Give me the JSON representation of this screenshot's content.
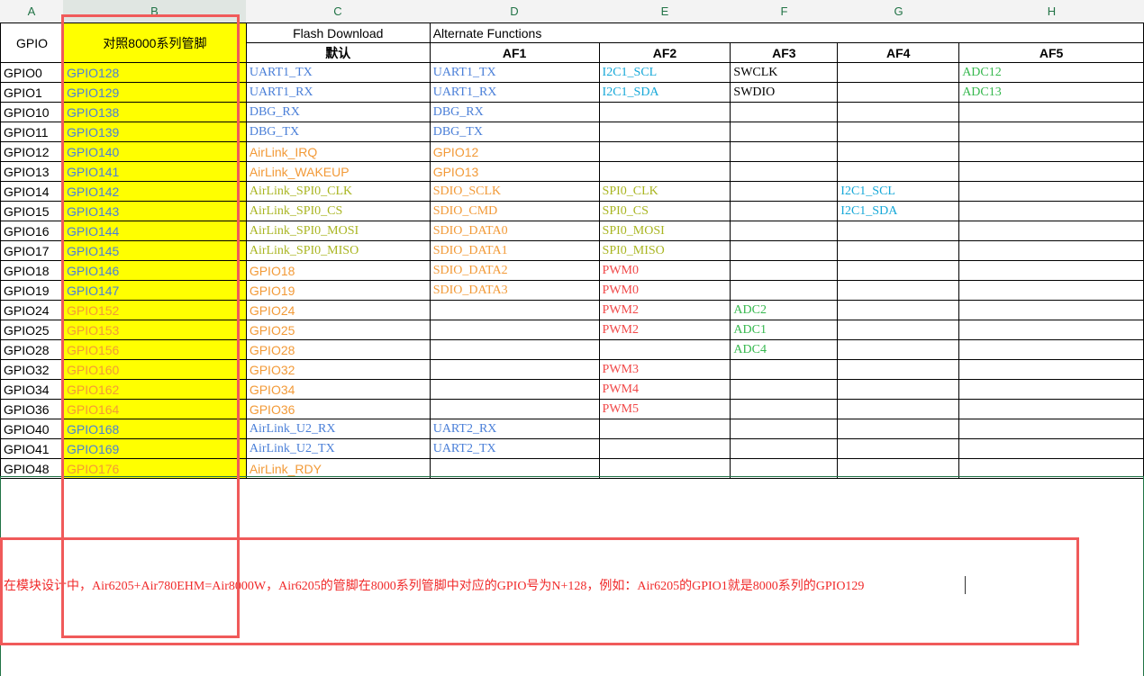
{
  "columns": [
    "A",
    "B",
    "C",
    "D",
    "E",
    "F",
    "G",
    "H"
  ],
  "header": {
    "gpio": "GPIO",
    "mapping": "对照8000系列管脚",
    "flash_download": "Flash Download",
    "alternate_functions": "Alternate Functions",
    "default": "默认",
    "af1": "AF1",
    "af2": "AF2",
    "af3": "AF3",
    "af4": "AF4",
    "af5": "AF5"
  },
  "rows": [
    {
      "gpio": "GPIO0",
      "b": "GPIO128",
      "c": "UART1_TX",
      "d": "UART1_TX",
      "e": "I2C1_SCL",
      "f": "SWCLK",
      "g": "",
      "h": "ADC12"
    },
    {
      "gpio": "GPIO1",
      "b": "GPIO129",
      "c": "UART1_RX",
      "d": "UART1_RX",
      "e": "I2C1_SDA",
      "f": "SWDIO",
      "g": "",
      "h": "ADC13"
    },
    {
      "gpio": "GPIO10",
      "b": "GPIO138",
      "c": "DBG_RX",
      "d": "DBG_RX",
      "e": "",
      "f": "",
      "g": "",
      "h": ""
    },
    {
      "gpio": "GPIO11",
      "b": "GPIO139",
      "c": "DBG_TX",
      "d": "DBG_TX",
      "e": "",
      "f": "",
      "g": "",
      "h": ""
    },
    {
      "gpio": "GPIO12",
      "b": "GPIO140",
      "c": "AirLink_IRQ",
      "d": "GPIO12",
      "e": "",
      "f": "",
      "g": "",
      "h": ""
    },
    {
      "gpio": "GPIO13",
      "b": "GPIO141",
      "c": "AirLink_WAKEUP",
      "d": "GPIO13",
      "e": "",
      "f": "",
      "g": "",
      "h": ""
    },
    {
      "gpio": "GPIO14",
      "b": "GPIO142",
      "c": "AirLink_SPI0_CLK",
      "d": "SDIO_SCLK",
      "e": "SPI0_CLK",
      "f": "",
      "g": "I2C1_SCL",
      "h": ""
    },
    {
      "gpio": "GPIO15",
      "b": "GPIO143",
      "c": "AirLink_SPI0_CS",
      "d": "SDIO_CMD",
      "e": "SPI0_CS",
      "f": "",
      "g": "I2C1_SDA",
      "h": ""
    },
    {
      "gpio": "GPIO16",
      "b": "GPIO144",
      "c": "AirLink_SPI0_MOSI",
      "d": "SDIO_DATA0",
      "e": "SPI0_MOSI",
      "f": "",
      "g": "",
      "h": ""
    },
    {
      "gpio": "GPIO17",
      "b": "GPIO145",
      "c": "AirLink_SPI0_MISO",
      "d": "SDIO_DATA1",
      "e": "SPI0_MISO",
      "f": "",
      "g": "",
      "h": ""
    },
    {
      "gpio": "GPIO18",
      "b": "GPIO146",
      "c": "GPIO18",
      "d": "SDIO_DATA2",
      "e": "PWM0",
      "f": "",
      "g": "",
      "h": ""
    },
    {
      "gpio": "GPIO19",
      "b": "GPIO147",
      "c": "GPIO19",
      "d": "SDIO_DATA3",
      "e": "PWM0",
      "f": "",
      "g": "",
      "h": ""
    },
    {
      "gpio": "GPIO24",
      "b": "GPIO152",
      "c": "GPIO24",
      "d": "",
      "e": "PWM2",
      "f": "ADC2",
      "g": "",
      "h": ""
    },
    {
      "gpio": "GPIO25",
      "b": "GPIO153",
      "c": "GPIO25",
      "d": "",
      "e": "PWM2",
      "f": "ADC1",
      "g": "",
      "h": ""
    },
    {
      "gpio": "GPIO28",
      "b": "GPIO156",
      "c": "GPIO28",
      "d": "",
      "e": "",
      "f": "ADC4",
      "g": "",
      "h": ""
    },
    {
      "gpio": "GPIO32",
      "b": "GPIO160",
      "c": "GPIO32",
      "d": "",
      "e": "PWM3",
      "f": "",
      "g": "",
      "h": ""
    },
    {
      "gpio": "GPIO34",
      "b": "GPIO162",
      "c": "GPIO34",
      "d": "",
      "e": "PWM4",
      "f": "",
      "g": "",
      "h": ""
    },
    {
      "gpio": "GPIO36",
      "b": "GPIO164",
      "c": "GPIO36",
      "d": "",
      "e": "PWM5",
      "f": "",
      "g": "",
      "h": ""
    },
    {
      "gpio": "GPIO40",
      "b": "GPIO168",
      "c": "AirLink_U2_RX",
      "d": "UART2_RX",
      "e": "",
      "f": "",
      "g": "",
      "h": ""
    },
    {
      "gpio": "GPIO41",
      "b": "GPIO169",
      "c": "AirLink_U2_TX",
      "d": "UART2_TX",
      "e": "",
      "f": "",
      "g": "",
      "h": ""
    },
    {
      "gpio": "GPIO48",
      "b": "GPIO176",
      "c": "AirLink_RDY",
      "d": "",
      "e": "",
      "f": "",
      "g": "",
      "h": ""
    }
  ],
  "note": "在模块设计中，Air6205+Air780EHM=Air8000W，Air6205的管脚在8000系列管脚中对应的GPIO号为N+128，例如：Air6205的GPIO1就是8000系列的GPIO129",
  "colors": {
    "blue": "#4a7fd8",
    "cyan": "#16a8d8",
    "orange": "#f29a38",
    "olive": "#a9b521",
    "red": "#f04848",
    "green": "#36b84e",
    "highlight": "#ffff00",
    "annotation": "#f05a5a"
  }
}
